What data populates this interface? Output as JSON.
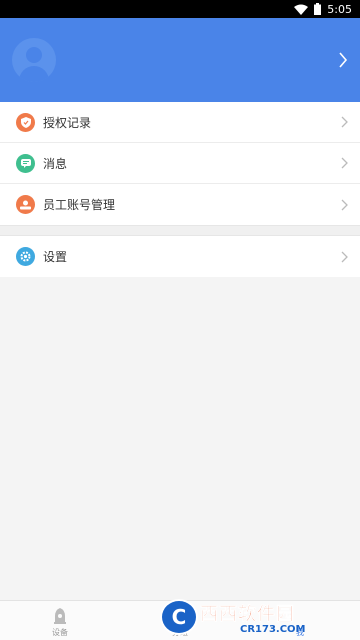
{
  "status_bar": {
    "time": "5:05"
  },
  "header": {
    "chevron_icon": "chevron-right-icon"
  },
  "menu": {
    "group1": [
      {
        "label": "授权记录",
        "icon": "shield-icon",
        "color": "#f07a4a"
      },
      {
        "label": "消息",
        "icon": "message-icon",
        "color": "#3fbf8f"
      },
      {
        "label": "员工账号管理",
        "icon": "staff-icon",
        "color": "#f07a4a"
      }
    ],
    "group2": [
      {
        "label": "设置",
        "icon": "gear-icon",
        "color": "#3fa9e0"
      }
    ]
  },
  "tabbar": {
    "tabs": [
      {
        "label": "设备",
        "active": false
      },
      {
        "label": "分组",
        "active": false
      },
      {
        "label": "我",
        "active": true
      }
    ]
  },
  "watermark": {
    "main": "西西软件园",
    "sub": "CR173.COM"
  },
  "colors": {
    "accent": "#4a84e8"
  }
}
